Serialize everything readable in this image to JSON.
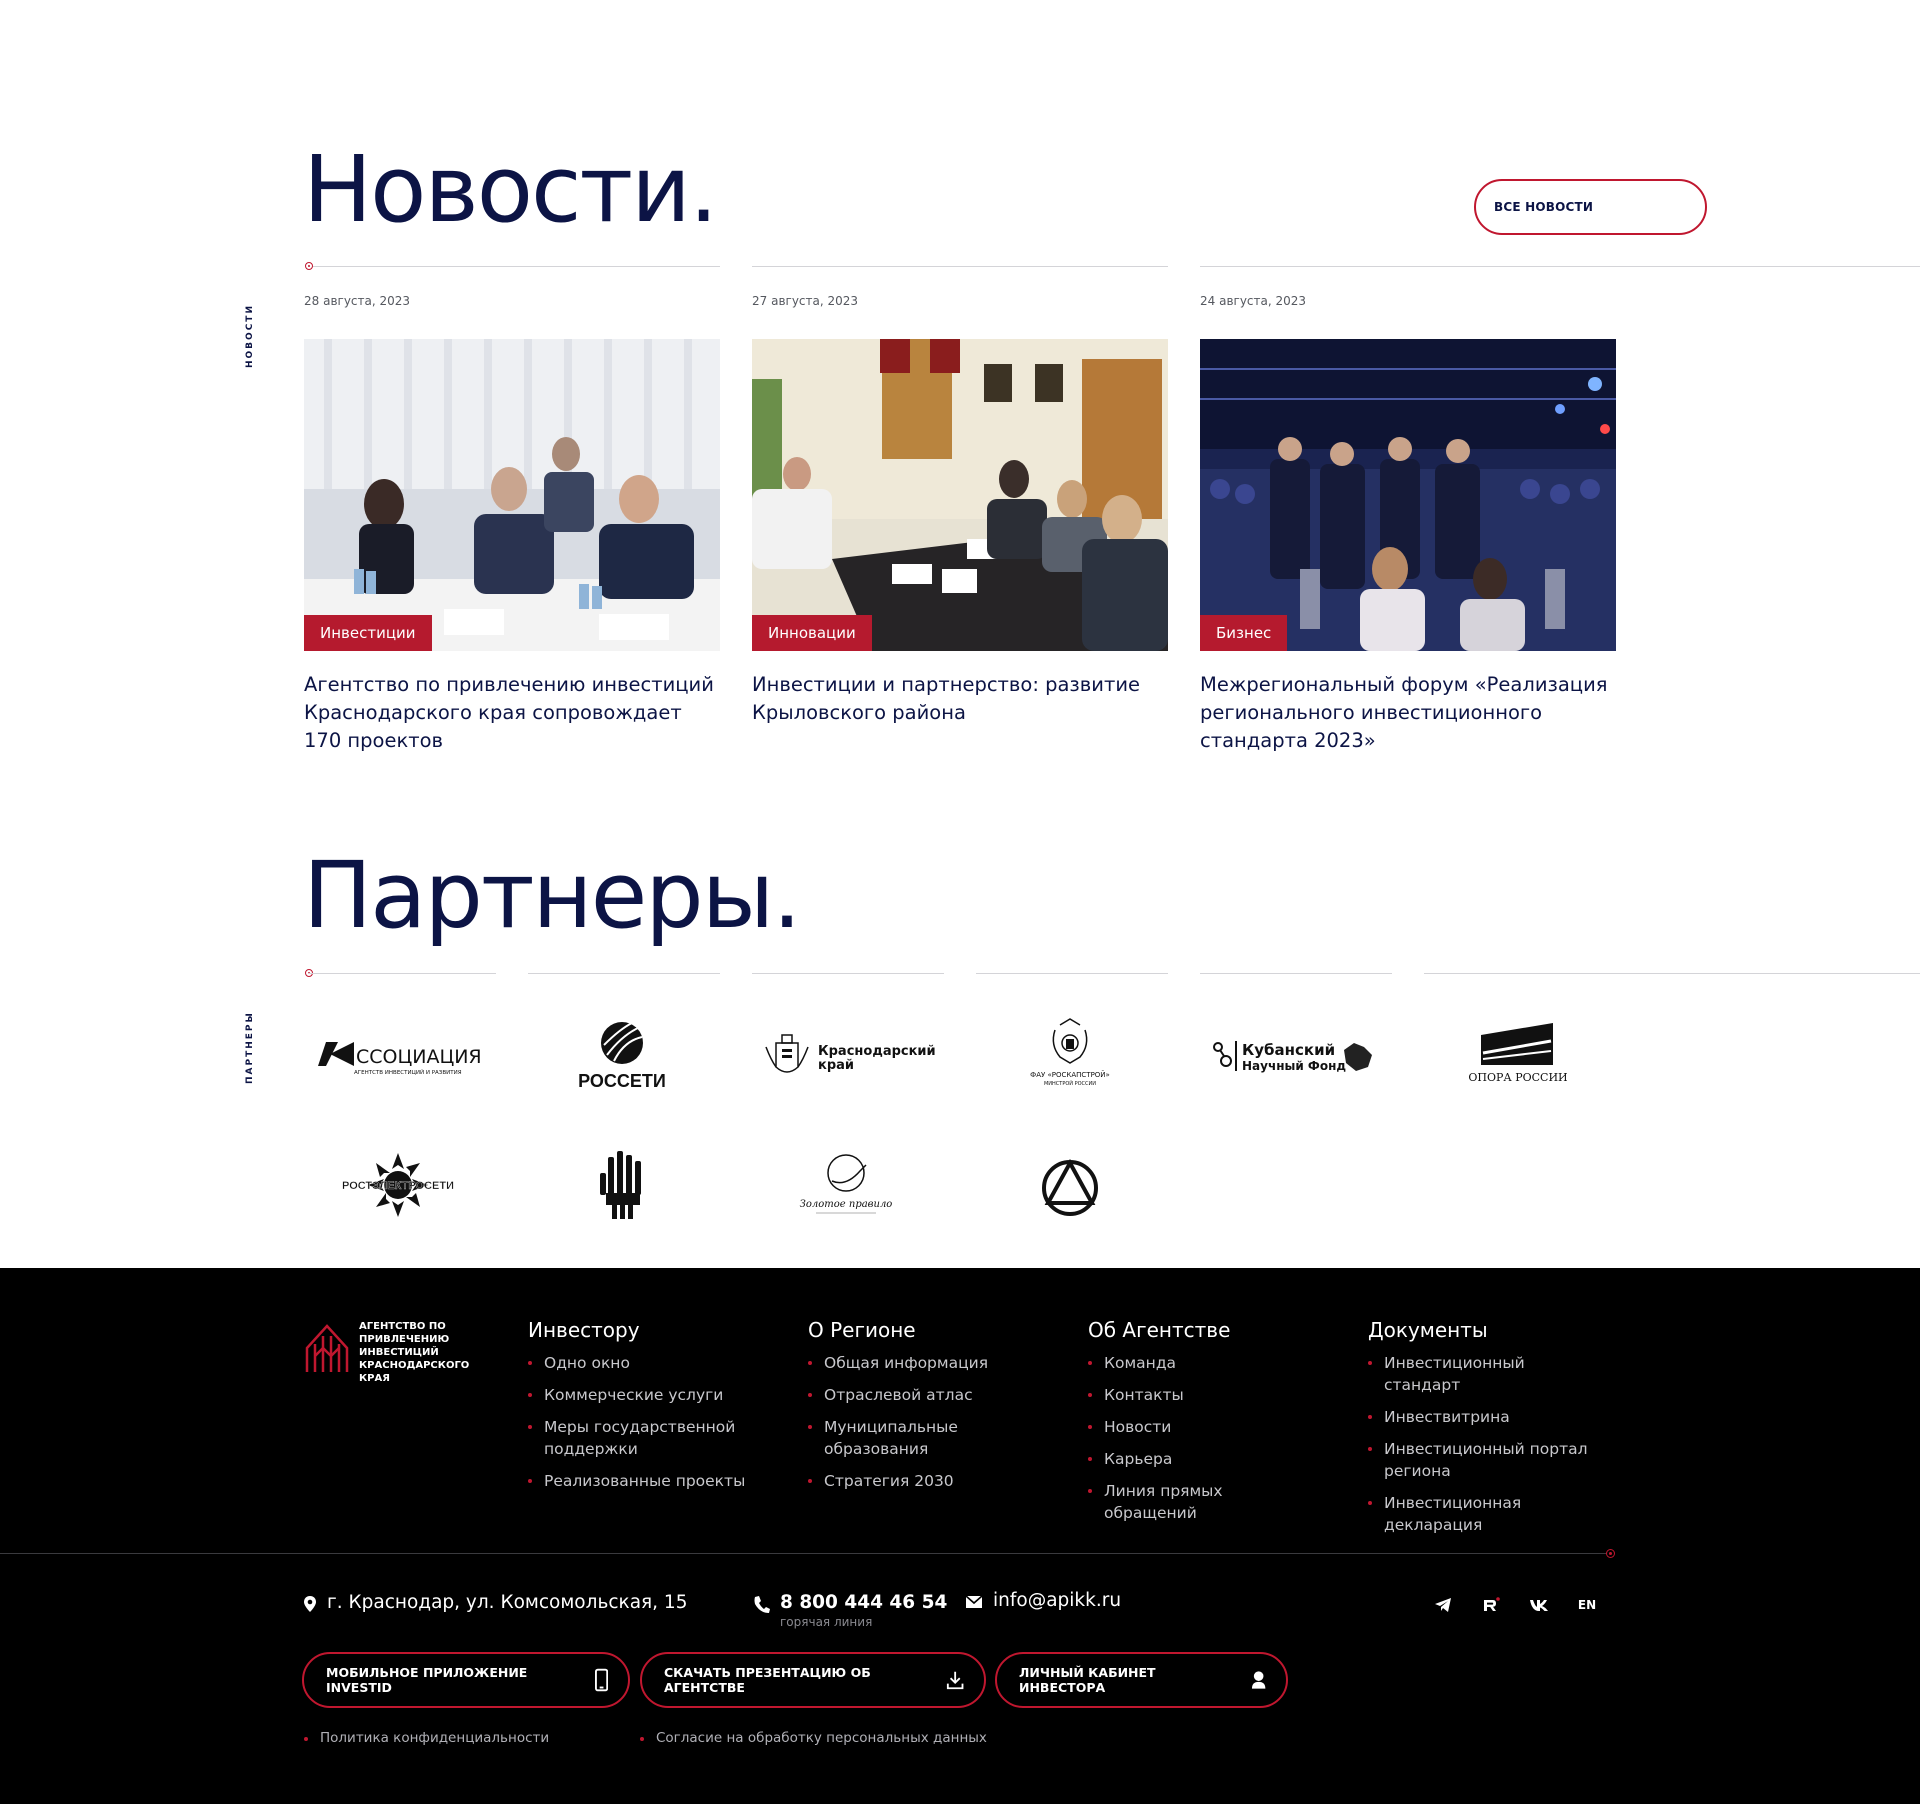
{
  "news": {
    "title": "Новости.",
    "side_label": "НОВОСТИ",
    "all_news_label": "ВСЕ НОВОСТИ",
    "items": [
      {
        "date": "28 августа, 2023",
        "tag": "Инвестиции",
        "headline": "Агентство по привлечению инвестиций Краснодарского края сопровождает 170 проектов"
      },
      {
        "date": "27 августа, 2023",
        "tag": "Инновации",
        "headline": "Инвестиции и партнерство: развитие Крыловского района"
      },
      {
        "date": "24 августа, 2023",
        "tag": "Бизнес",
        "headline": "Межрегиональный форум «Реализация регионального  инвестиционного стандарта 2023»"
      }
    ]
  },
  "partners": {
    "title": "Партнеры.",
    "side_label": "ПАРТНЕРЫ",
    "logos": [
      {
        "icon": "association-logo",
        "text": "ССОЦИАЦИЯ",
        "sub": "АГЕНТСТВ ИНВЕСТИЦИЙ И РАЗВИТИЯ"
      },
      {
        "icon": "rosseti-logo",
        "text": "РОССЕТИ"
      },
      {
        "icon": "krasnodar-krai-logo",
        "text": "Краснодарский",
        "text2": "край"
      },
      {
        "icon": "fau-roskapstroy-logo",
        "text": "ФАУ «РОСКАПСТРОЙ»",
        "sub": "МИНСТРОЙ РОССИИ"
      },
      {
        "icon": "kuban-science-fund-logo",
        "text": "Кубанский",
        "text2": "Научный Фонд"
      },
      {
        "icon": "opora-rossii-logo",
        "text": "ОПОРА РОССИИ"
      },
      {
        "icon": "rostelecom-seti-logo",
        "text": "РОСТЭЛЕКТРОСЕТИ"
      },
      {
        "icon": "sberbank-hand-logo"
      },
      {
        "icon": "signature-logo",
        "text": "Золотое правило"
      },
      {
        "icon": "triangle-circle-logo"
      }
    ]
  },
  "footer": {
    "logo_text": "АГЕНТСТВО ПО ПРИВЛЕЧЕНИЮ ИНВЕСТИЦИЙ КРАСНОДАРСКОГО КРАЯ",
    "columns": [
      {
        "title": "Инвестору",
        "items": [
          "Одно окно",
          "Коммерческие услуги",
          "Меры государственной поддержки",
          "Реализованные проекты"
        ]
      },
      {
        "title": "О Регионе",
        "items": [
          "Общая информация",
          "Отраслевой атлас",
          "Муниципальные образования",
          "Стратегия 2030"
        ]
      },
      {
        "title": "Об Агентстве",
        "items": [
          "Команда",
          "Контакты",
          "Новости",
          "Карьера",
          "Линия прямых обращений"
        ]
      },
      {
        "title": "Документы",
        "items": [
          "Инвестиционный стандарт",
          "Инвествитрина",
          "Инвестиционный портал региона",
          "Инвестиционная декларация"
        ]
      }
    ],
    "address": "г. Краснодар, ул. Комсомольская, 15",
    "phone": "8 800 444 46 54",
    "phone_note": "горячая линия",
    "email": "info@apikk.ru",
    "socials": [
      "telegram-icon",
      "rutube-icon",
      "vk-icon"
    ],
    "lang": "EN",
    "buttons": [
      {
        "label": "МОБИЛЬНОЕ ПРИЛОЖЕНИЕ INVESTID",
        "icon": "phone-icon"
      },
      {
        "label": "СКАЧАТЬ ПРЕЗЕНТАЦИЮ ОБ АГЕНТСТВЕ",
        "icon": "download-icon"
      },
      {
        "label": "ЛИЧНЫЙ КАБИНЕТ ИНВЕСТОРА",
        "icon": "user-icon"
      }
    ],
    "legal": [
      "Политика конфиденциальности",
      "Согласие на обработку персональных данных"
    ]
  },
  "colors": {
    "navy": "#0c1445",
    "accent": "#c0172f",
    "footer_bg": "#000000"
  }
}
